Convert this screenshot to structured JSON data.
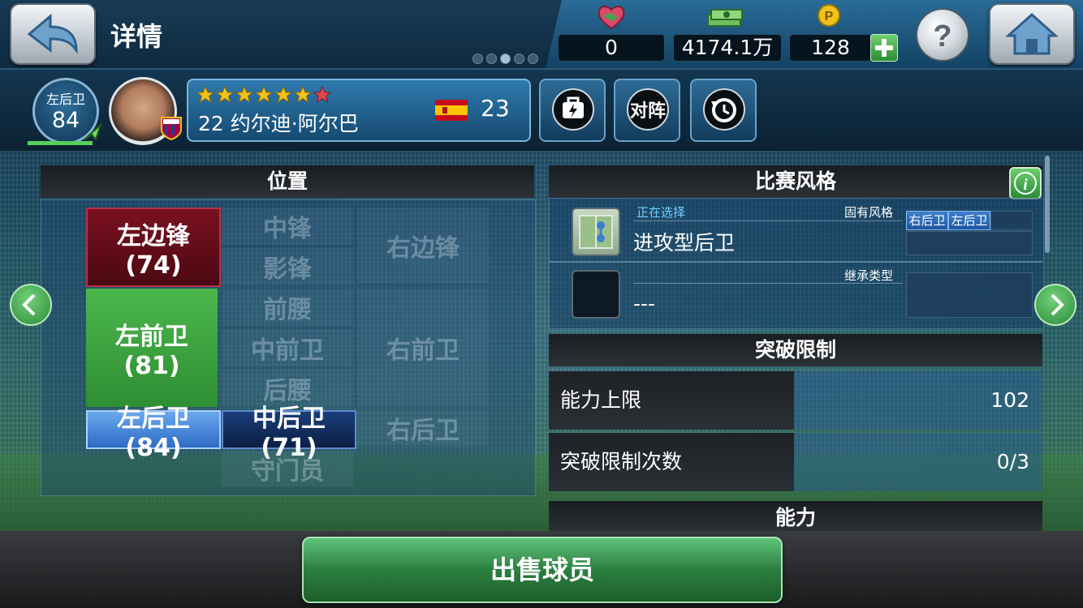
{
  "header": {
    "title": "详情",
    "back_icon": "back-arrow-icon",
    "help_icon": "question-mark-icon",
    "home_icon": "home-icon",
    "page_dots": 5,
    "active_dot": 2
  },
  "currencies": [
    {
      "icon": "handshake-icon",
      "value": "0"
    },
    {
      "icon": "cash-icon",
      "value": "4174.1万"
    },
    {
      "icon": "p-coin-icon",
      "value": "128"
    }
  ],
  "player": {
    "position": "左后卫",
    "rating": "84",
    "name": "22 约尔迪·阿尔巴",
    "age": "23",
    "stars_gold": 6,
    "stars_red": 1,
    "nation_flag": "spain-flag-icon",
    "club_badge": "barcelona-badge-icon"
  },
  "actions": [
    {
      "name": "transfer-lock-button",
      "icon": "bag-lightning-icon",
      "label": ""
    },
    {
      "name": "matchup-button",
      "icon": "",
      "label": "对阵"
    },
    {
      "name": "history-button",
      "icon": "clock-icon",
      "label": ""
    }
  ],
  "positions_panel": {
    "title": "位置",
    "cells": {
      "lwf": "左边锋 (74)",
      "cf": "中锋",
      "rwf": "右边锋",
      "ss": "影锋",
      "amf": "前腰",
      "lmf": "左前卫 (81)",
      "cmf": "中前卫",
      "rmf": "右前卫",
      "dmf": "后腰",
      "lb": "左后卫 (84)",
      "cb": "中后卫 (71)",
      "rb": "右后卫",
      "gk": "守门员"
    }
  },
  "playstyle_panel": {
    "title": "比赛风格",
    "info_icon": "info-icon",
    "selecting_label": "正在选择",
    "selected_style": "进攻型后卫",
    "inherent_label": "固有风格",
    "inherent_tags": [
      "右后卫",
      "左后卫"
    ],
    "inherit_label": "继承类型",
    "inherit_value": "---"
  },
  "limit_panel": {
    "title": "突破限制",
    "rows": [
      {
        "label": "能力上限",
        "value": "102"
      },
      {
        "label": "突破限制次数",
        "value": "0/3"
      }
    ]
  },
  "ability_panel": {
    "title": "能力"
  },
  "footer": {
    "sell_label": "出售球员"
  },
  "colors": {
    "accent_green": "#2e8e33",
    "dark_red": "#7a1020",
    "blue_highlight": "#2d6cc4"
  }
}
